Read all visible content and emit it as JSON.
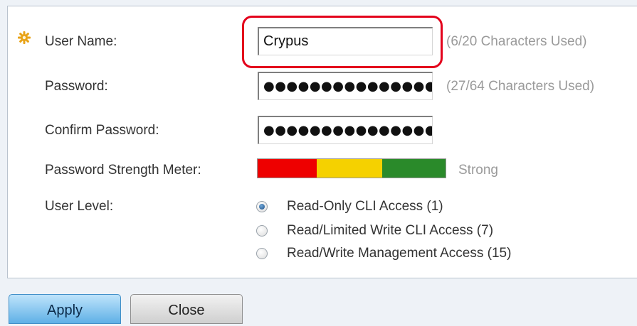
{
  "form": {
    "user_name": {
      "label": "User Name:",
      "value": "Crypus",
      "hint": "(6/20 Characters Used)"
    },
    "password": {
      "label": "Password:",
      "value": "●●●●●●●●●●●●●●●●●●●",
      "hint": "(27/64 Characters Used)"
    },
    "confirm_password": {
      "label": "Confirm Password:",
      "value": "●●●●●●●●●●●●●●●●●●●"
    },
    "strength": {
      "label": "Password Strength Meter:",
      "status": "Strong",
      "colors": [
        "#ee0000",
        "#f5d100",
        "#2a8a2a"
      ],
      "level": 3,
      "max_level": 3
    },
    "user_level": {
      "label": "User Level:",
      "options": [
        {
          "label": "Read-Only CLI Access (1)",
          "checked": true
        },
        {
          "label": "Read/Limited Write CLI Access (7)",
          "checked": false
        },
        {
          "label": "Read/Write Management Access (15)",
          "checked": false
        }
      ]
    }
  },
  "buttons": {
    "apply": "Apply",
    "close": "Close"
  },
  "colors": {
    "highlight": "#e3001b",
    "required_icon": "#e8a317",
    "accent": "#5fb0e6"
  }
}
